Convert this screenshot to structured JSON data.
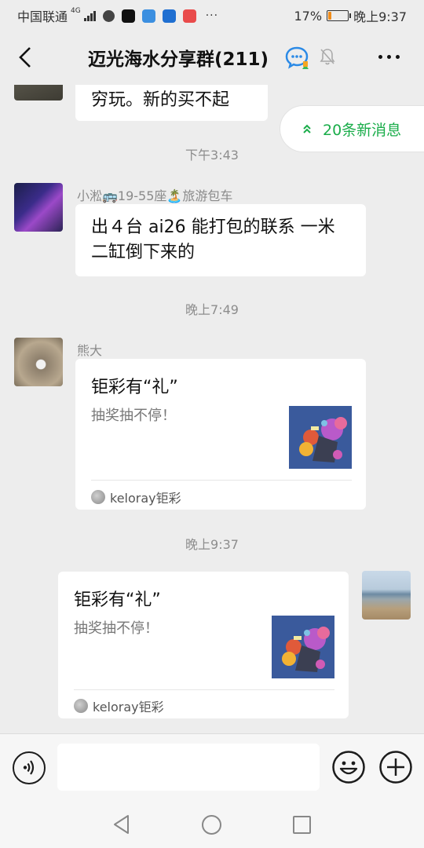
{
  "status_bar": {
    "carrier": "中国联通",
    "network": "4G",
    "battery": "17%",
    "battery_level": 0.17,
    "time": "晚上9:37",
    "more": "···"
  },
  "header": {
    "title": "迈光海水分享群(211)"
  },
  "new_messages": {
    "label": "20条新消息"
  },
  "messages": [
    {
      "type": "text",
      "direction": "incoming",
      "text": "穷玩。新的买不起"
    },
    {
      "type": "timestamp",
      "text": "下午3:43"
    },
    {
      "type": "text",
      "direction": "incoming",
      "sender": "小淞🚌19-55座🏝️旅游包车",
      "text": "出４台 ai26 能打包的联系 一米二缸倒下来的"
    },
    {
      "type": "timestamp",
      "text": "晚上7:49"
    },
    {
      "type": "card",
      "direction": "incoming",
      "sender": "熊大",
      "title": "钜彩有“礼”",
      "desc": "抽奖抽不停！",
      "source": "keloray钜彩"
    },
    {
      "type": "timestamp",
      "text": "晚上9:37"
    },
    {
      "type": "card",
      "direction": "outgoing",
      "title": "钜彩有“礼”",
      "desc": "抽奖抽不停！",
      "source": "keloray钜彩"
    }
  ],
  "input": {
    "placeholder": ""
  },
  "colors": {
    "background": "#ededed",
    "accent_green": "#1aad4a",
    "battery_orange": "#f08c1a"
  },
  "icons": [
    "back-arrow-icon",
    "group-chat-icon",
    "mute-bell-icon",
    "more-icon",
    "voice-icon",
    "emoji-icon",
    "plus-icon",
    "nav-back-icon",
    "nav-home-icon",
    "nav-recent-icon",
    "double-chevron-up-icon"
  ]
}
